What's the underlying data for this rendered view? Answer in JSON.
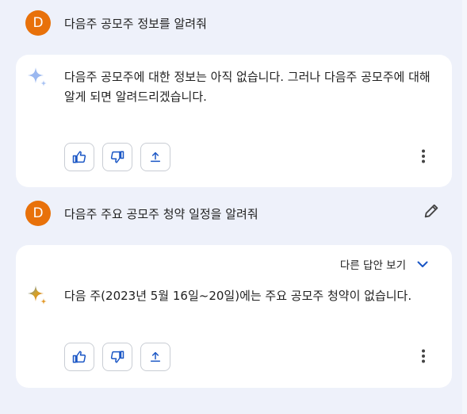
{
  "conversation": {
    "user_messages": [
      {
        "avatar_letter": "D",
        "text": "다음주 공모주 정보를 알려줘"
      },
      {
        "avatar_letter": "D",
        "text": "다음주 주요 공모주 청약 일정을 알려줘"
      }
    ],
    "responses": [
      {
        "text": "다음주 공모주에 대한 정보는 아직 없습니다. 그러나 다음주 공모주에 대해 알게 되면 알려드리겠습니다."
      },
      {
        "drafts_label": "다른 답안 보기",
        "text": "다음 주(2023년 5월 16일~20일)에는 주요 공모주 청약이 없습니다."
      }
    ]
  },
  "icons": {
    "avatar_color": "#e8710a",
    "sparkle_faded_color": "#9bb8f0",
    "action_icon_color": "#1a56c5",
    "like": "thumbs-up-icon",
    "dislike": "thumbs-down-icon",
    "share": "share-icon",
    "more": "more-vert-icon",
    "edit": "edit-pencil-icon",
    "expand": "chevron-down-icon"
  }
}
